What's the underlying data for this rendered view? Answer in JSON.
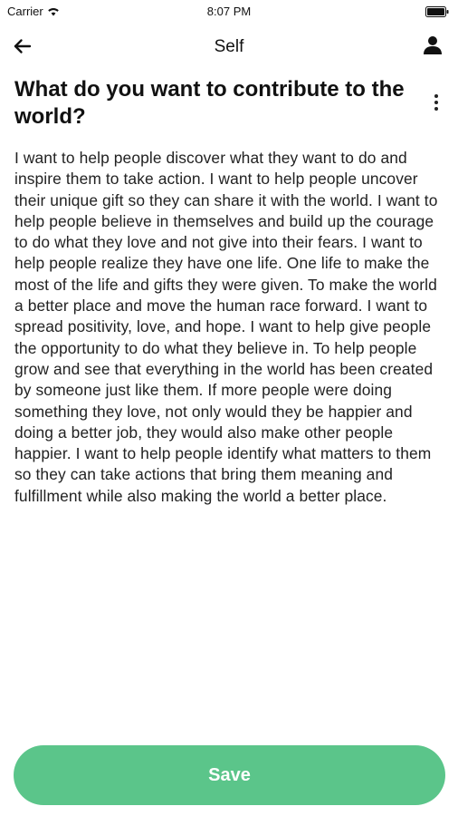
{
  "status_bar": {
    "carrier": "Carrier",
    "time": "8:07 PM"
  },
  "nav": {
    "title": "Self",
    "back_icon": "back-arrow-icon",
    "profile_icon": "person-icon"
  },
  "question": {
    "title": "What do you want to contribute to the world?",
    "menu_icon": "more-vertical-icon"
  },
  "answer": {
    "text": "I want to help people discover what they want to do and inspire them to take action. I want to help people uncover their unique gift so they can share it with the world. I want to help people believe in themselves and build up the courage to do what they love and not give into their fears. I want to help people realize they have one life. One life to make the most of the life and gifts they were given. To make the world a better place and move the human race forward. I want to spread positivity, love, and hope. I want to help give people the opportunity to do what they believe in. To help people grow and see that everything in the world has been created by someone just like them. If more people were doing something they love, not only would they be happier and doing a better job, they would also make other people happier. I want to help people identify what matters to them so they can take actions that bring them meaning and fulfillment while also making the world a better place."
  },
  "actions": {
    "save_label": "Save"
  },
  "colors": {
    "accent": "#5bc58a",
    "text": "#111111",
    "background": "#ffffff"
  }
}
